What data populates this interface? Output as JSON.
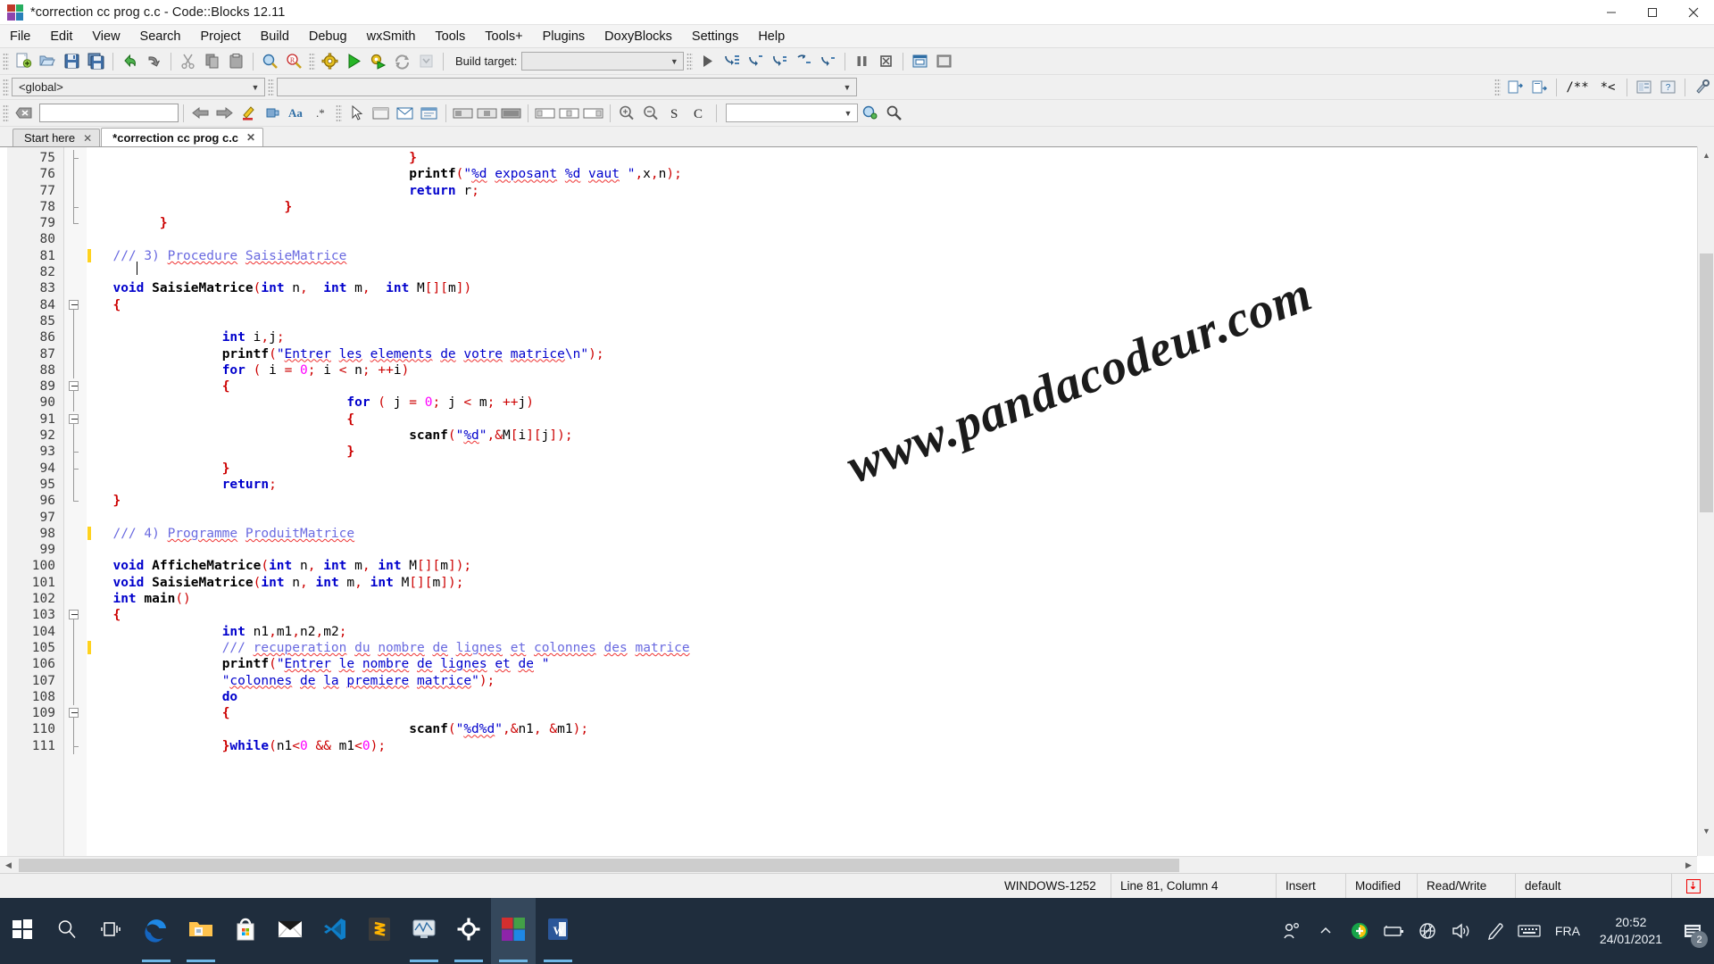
{
  "window": {
    "title": "*correction cc prog c.c - Code::Blocks 12.11",
    "app_icon": "codeblocks-icon",
    "controls": {
      "minimize": "minimize-icon",
      "maximize": "maximize-icon",
      "close": "close-icon"
    }
  },
  "menubar": {
    "items": [
      {
        "label": "File"
      },
      {
        "label": "Edit"
      },
      {
        "label": "View"
      },
      {
        "label": "Search"
      },
      {
        "label": "Project"
      },
      {
        "label": "Build"
      },
      {
        "label": "Debug"
      },
      {
        "label": "wxSmith"
      },
      {
        "label": "Tools"
      },
      {
        "label": "Tools+"
      },
      {
        "label": "Plugins"
      },
      {
        "label": "DoxyBlocks"
      },
      {
        "label": "Settings"
      },
      {
        "label": "Help"
      }
    ]
  },
  "toolbar_main": {
    "build_target_label": "Build target:",
    "build_target_value": "",
    "buttons": [
      "new-file-icon",
      "open-file-icon",
      "save-icon",
      "save-all-icon",
      "undo-icon",
      "redo-icon",
      "cut-icon",
      "copy-icon",
      "paste-icon",
      "find-icon",
      "replace-icon",
      "build-icon",
      "run-icon",
      "build-and-run-icon",
      "rebuild-icon",
      "abort-icon",
      "debug-continue-icon",
      "debug-run-to-cursor-icon",
      "debug-next-line-icon",
      "debug-step-into-icon",
      "debug-step-out-icon",
      "debug-next-instruction-icon",
      "debug-step-instruction-icon",
      "debug-break-icon",
      "debug-stop-icon",
      "debugging-windows-icon",
      "various-info-icon"
    ]
  },
  "toolbar_scope": {
    "scope_value": "<global>",
    "function_value": "",
    "doxyblocks_buttons": [
      "doxyblocks-extract-icon",
      "doxyblocks-run-icon",
      "doxyblocks-comment-block-icon",
      "doxyblocks-comment-line-icon",
      "doxyblocks-wizard-icon",
      "doxyblocks-help-icon",
      "doxyblocks-config-icon"
    ],
    "doxy_labels": {
      "block": "/**",
      "line": "*<"
    }
  },
  "toolbar_tools": {
    "search_value": "",
    "search_placeholder": "",
    "goto_value": "",
    "buttons": [
      "clear-icon",
      "back-icon",
      "forward-icon",
      "highlight-icon",
      "toggle-bookmark-icon",
      "match-case-icon",
      "regex-icon",
      "pointer-icon",
      "panel-icon",
      "dialog-icon",
      "frame-icon",
      "layout-1-icon",
      "layout-2-icon",
      "layout-3-icon",
      "box-1-icon",
      "box-2-icon",
      "box-3-icon",
      "zoom-in-icon",
      "zoom-out-icon",
      "smart-indent-icon",
      "comment-icon",
      "goto-icon",
      "find-symbol-icon"
    ]
  },
  "editor_tabs": [
    {
      "label": "Start here",
      "active": false,
      "close_icon": "close-tab-icon"
    },
    {
      "label": "*correction cc prog c.c",
      "active": true,
      "close_icon": "close-tab-icon"
    }
  ],
  "editor": {
    "first_line": 75,
    "caret_line": 81,
    "watermark": "www.pandacodeur.com",
    "lines": [
      {
        "n": 75,
        "mark": false,
        "fold": "tee",
        "html": "                                        <span class=\"brc\">}</span>"
      },
      {
        "n": 76,
        "mark": false,
        "fold": "line",
        "html": "                                        <span class=\"fn\">printf</span><span class=\"pun\">(</span><span class=\"str\">\"</span><span class=\"str sq\">%d</span><span class=\"str\"> </span><span class=\"str sq\">exposant</span><span class=\"str\"> </span><span class=\"str sq\">%d</span><span class=\"str\"> </span><span class=\"str sq\">vaut</span><span class=\"str\"> \"</span><span class=\"pun\">,</span>x<span class=\"pun\">,</span>n<span class=\"pun\">);</span>"
      },
      {
        "n": 77,
        "mark": false,
        "fold": "line",
        "html": "                                        <span class=\"kw\">return</span> r<span class=\"pun\">;</span>"
      },
      {
        "n": 78,
        "mark": false,
        "fold": "tee",
        "html": "                        <span class=\"brc\">}</span>"
      },
      {
        "n": 79,
        "mark": false,
        "fold": "end",
        "html": "        <span class=\"brc\">}</span>"
      },
      {
        "n": 80,
        "mark": false,
        "fold": "",
        "html": ""
      },
      {
        "n": 81,
        "mark": true,
        "fold": "",
        "html": "  <span class=\"cmt\">///</span><span class=\"caret-here\"></span><span class=\"cmt\"> 3) </span><span class=\"cmt sq\">Procedure</span><span class=\"cmt\"> </span><span class=\"cmt sq\">SaisieMatrice</span>"
      },
      {
        "n": 82,
        "mark": false,
        "fold": "",
        "html": ""
      },
      {
        "n": 83,
        "mark": false,
        "fold": "",
        "html": "  <span class=\"ty\">void</span> <span class=\"fn\">SaisieMatrice</span><span class=\"pun\">(</span><span class=\"ty\">int</span> n<span class=\"pun\">,</span>  <span class=\"ty\">int</span> m<span class=\"pun\">,</span>  <span class=\"ty\">int</span> M<span class=\"pun\">[][</span>m<span class=\"pun\">])</span>"
      },
      {
        "n": 84,
        "mark": false,
        "fold": "box",
        "html": "  <span class=\"brc\">{</span>"
      },
      {
        "n": 85,
        "mark": false,
        "fold": "line",
        "html": ""
      },
      {
        "n": 86,
        "mark": false,
        "fold": "line",
        "html": "                <span class=\"ty\">int</span> i<span class=\"pun\">,</span>j<span class=\"pun\">;</span>"
      },
      {
        "n": 87,
        "mark": false,
        "fold": "line",
        "html": "                <span class=\"fn\">printf</span><span class=\"pun\">(</span><span class=\"str\">\"</span><span class=\"str sq\">Entrer</span><span class=\"str\"> </span><span class=\"str sq\">les</span><span class=\"str\"> </span><span class=\"str sq\">elements</span><span class=\"str\"> </span><span class=\"str sq\">de</span><span class=\"str\"> </span><span class=\"str sq\">votre</span><span class=\"str\"> </span><span class=\"str sq\">matrice</span><span class=\"str\">\\n\"</span><span class=\"pun\">);</span>"
      },
      {
        "n": 88,
        "mark": false,
        "fold": "line",
        "html": "                <span class=\"kw\">for</span> <span class=\"pun\">(</span> i <span class=\"op\">=</span> <span class=\"num\">0</span><span class=\"pun\">;</span> i <span class=\"op\">&lt;</span> n<span class=\"pun\">;</span> <span class=\"op\">++</span>i<span class=\"pun\">)</span>"
      },
      {
        "n": 89,
        "mark": false,
        "fold": "box",
        "html": "                <span class=\"brc\">{</span>"
      },
      {
        "n": 90,
        "mark": false,
        "fold": "line",
        "html": "                                <span class=\"kw\">for</span> <span class=\"pun\">(</span> j <span class=\"op\">=</span> <span class=\"num\">0</span><span class=\"pun\">;</span> j <span class=\"op\">&lt;</span> m<span class=\"pun\">;</span> <span class=\"op\">++</span>j<span class=\"pun\">)</span>"
      },
      {
        "n": 91,
        "mark": false,
        "fold": "box",
        "html": "                                <span class=\"brc\">{</span>"
      },
      {
        "n": 92,
        "mark": false,
        "fold": "line",
        "html": "                                        <span class=\"fn\">scanf</span><span class=\"pun\">(</span><span class=\"str\">\"</span><span class=\"str sq\">%d</span><span class=\"str\">\"</span><span class=\"pun\">,&amp;</span>M<span class=\"pun\">[</span>i<span class=\"pun\">][</span>j<span class=\"pun\">]);</span>"
      },
      {
        "n": 93,
        "mark": false,
        "fold": "tee",
        "html": "                                <span class=\"brc\">}</span>"
      },
      {
        "n": 94,
        "mark": false,
        "fold": "tee",
        "html": "                <span class=\"brc\">}</span>"
      },
      {
        "n": 95,
        "mark": false,
        "fold": "line",
        "html": "                <span class=\"kw\">return</span><span class=\"pun\">;</span>"
      },
      {
        "n": 96,
        "mark": false,
        "fold": "end",
        "html": "  <span class=\"brc\">}</span>"
      },
      {
        "n": 97,
        "mark": false,
        "fold": "",
        "html": ""
      },
      {
        "n": 98,
        "mark": true,
        "fold": "",
        "html": "  <span class=\"cmt\">/// 4) </span><span class=\"cmt sq\">Programme</span><span class=\"cmt\"> </span><span class=\"cmt sq\">ProduitMatrice</span>"
      },
      {
        "n": 99,
        "mark": false,
        "fold": "",
        "html": ""
      },
      {
        "n": 100,
        "mark": false,
        "fold": "",
        "html": "  <span class=\"ty\">void</span> <span class=\"fn\">AfficheMatrice</span><span class=\"pun\">(</span><span class=\"ty\">int</span> n<span class=\"pun\">,</span> <span class=\"ty\">int</span> m<span class=\"pun\">,</span> <span class=\"ty\">int</span> M<span class=\"pun\">[][</span>m<span class=\"pun\">]);</span>"
      },
      {
        "n": 101,
        "mark": false,
        "fold": "",
        "html": "  <span class=\"ty\">void</span> <span class=\"fn\">SaisieMatrice</span><span class=\"pun\">(</span><span class=\"ty\">int</span> n<span class=\"pun\">,</span> <span class=\"ty\">int</span> m<span class=\"pun\">,</span> <span class=\"ty\">int</span> M<span class=\"pun\">[][</span>m<span class=\"pun\">]);</span>"
      },
      {
        "n": 102,
        "mark": false,
        "fold": "",
        "html": "  <span class=\"ty\">int</span> <span class=\"fn\">main</span><span class=\"pun\">()</span>"
      },
      {
        "n": 103,
        "mark": false,
        "fold": "box",
        "html": "  <span class=\"brc\">{</span>"
      },
      {
        "n": 104,
        "mark": false,
        "fold": "line",
        "html": "                <span class=\"ty\">int</span> n1<span class=\"pun\">,</span>m1<span class=\"pun\">,</span>n2<span class=\"pun\">,</span>m2<span class=\"pun\">;</span>"
      },
      {
        "n": 105,
        "mark": true,
        "fold": "line",
        "html": "                <span class=\"cmt\">/// </span><span class=\"cmt sq\">recuperation</span><span class=\"cmt\"> </span><span class=\"cmt sq\">du</span><span class=\"cmt\"> </span><span class=\"cmt sq\">nombre</span><span class=\"cmt\"> </span><span class=\"cmt sq\">de</span><span class=\"cmt\"> </span><span class=\"cmt sq\">lignes</span><span class=\"cmt\"> </span><span class=\"cmt sq\">et</span><span class=\"cmt\"> </span><span class=\"cmt sq\">colonnes</span><span class=\"cmt\"> </span><span class=\"cmt sq\">des</span><span class=\"cmt\"> </span><span class=\"cmt sq\">matrice</span>"
      },
      {
        "n": 106,
        "mark": false,
        "fold": "line",
        "html": "                <span class=\"fn\">printf</span><span class=\"pun\">(</span><span class=\"str\">\"</span><span class=\"str sq\">Entrer</span><span class=\"str\"> </span><span class=\"str sq\">le</span><span class=\"str\"> </span><span class=\"str sq\">nombre</span><span class=\"str\"> </span><span class=\"str sq\">de</span><span class=\"str\"> </span><span class=\"str sq\">lignes</span><span class=\"str\"> </span><span class=\"str sq\">et</span><span class=\"str\"> </span><span class=\"str sq\">de</span><span class=\"str\"> \"</span>"
      },
      {
        "n": 107,
        "mark": false,
        "fold": "line",
        "html": "                <span class=\"str\">\"</span><span class=\"str sq\">colonnes</span><span class=\"str\"> </span><span class=\"str sq\">de</span><span class=\"str\"> </span><span class=\"str sq\">la</span><span class=\"str\"> </span><span class=\"str sq\">premiere</span><span class=\"str\"> </span><span class=\"str sq\">matrice</span><span class=\"str\">\"</span><span class=\"pun\">);</span>"
      },
      {
        "n": 108,
        "mark": false,
        "fold": "line",
        "html": "                <span class=\"kw\">do</span>"
      },
      {
        "n": 109,
        "mark": false,
        "fold": "box",
        "html": "                <span class=\"brc\">{</span>"
      },
      {
        "n": 110,
        "mark": false,
        "fold": "line",
        "html": "                                        <span class=\"fn\">scanf</span><span class=\"pun\">(</span><span class=\"str\">\"</span><span class=\"str sq\">%d%d</span><span class=\"str\">\"</span><span class=\"pun\">,&amp;</span>n1<span class=\"pun\">,</span> <span class=\"pun\">&amp;</span>m1<span class=\"pun\">);</span>"
      },
      {
        "n": 111,
        "mark": false,
        "fold": "tee",
        "html": "                <span class=\"brc\">}</span><span class=\"kw\">while</span><span class=\"pun\">(</span>n1<span class=\"op\">&lt;</span><span class=\"num\">0</span> <span class=\"op\">&amp;&amp;</span> m1<span class=\"op\">&lt;</span><span class=\"num\">0</span><span class=\"pun\">);</span>"
      }
    ]
  },
  "statusbar": {
    "encoding": "WINDOWS-1252",
    "position": "Line 81, Column 4",
    "insert_mode": "Insert",
    "modified": "Modified",
    "access": "Read/Write",
    "profile": "default",
    "indicator_icon": "red-save-indicator-icon"
  },
  "taskbar": {
    "items": [
      {
        "name": "start-button",
        "icon": "windows-logo-icon",
        "active": false,
        "running": false
      },
      {
        "name": "search-button",
        "icon": "search-icon",
        "active": false,
        "running": false
      },
      {
        "name": "task-view-button",
        "icon": "task-view-icon",
        "active": false,
        "running": false
      },
      {
        "name": "edge-button",
        "icon": "edge-icon",
        "active": false,
        "running": true
      },
      {
        "name": "file-explorer-button",
        "icon": "folder-icon",
        "active": false,
        "running": true
      },
      {
        "name": "microsoft-store-button",
        "icon": "store-icon",
        "active": false,
        "running": false
      },
      {
        "name": "mail-button",
        "icon": "mail-icon",
        "active": false,
        "running": false
      },
      {
        "name": "vscode-button",
        "icon": "vscode-icon",
        "active": false,
        "running": false
      },
      {
        "name": "sublime-text-button",
        "icon": "sublime-icon",
        "active": false,
        "running": false
      },
      {
        "name": "media-button",
        "icon": "media-player-icon",
        "active": false,
        "running": true
      },
      {
        "name": "settings-button",
        "icon": "gear-icon",
        "active": false,
        "running": true
      },
      {
        "name": "codeblocks-button",
        "icon": "codeblocks-icon",
        "active": true,
        "running": true
      },
      {
        "name": "word-button",
        "icon": "word-icon",
        "active": false,
        "running": true
      }
    ],
    "tray": [
      {
        "name": "people-icon",
        "glyph": "people"
      },
      {
        "name": "show-hidden-icons-chevron",
        "glyph": "chevron-up"
      },
      {
        "name": "security-status-icon",
        "glyph": "shield"
      },
      {
        "name": "battery-icon",
        "glyph": "battery"
      },
      {
        "name": "network-icon",
        "glyph": "globe"
      },
      {
        "name": "volume-icon",
        "glyph": "speaker"
      },
      {
        "name": "pen-icon",
        "glyph": "pen"
      },
      {
        "name": "keyboard-icon",
        "glyph": "keyboard"
      }
    ],
    "language": "FRA",
    "time": "20:52",
    "date": "24/01/2021",
    "notifications_count": "2"
  }
}
